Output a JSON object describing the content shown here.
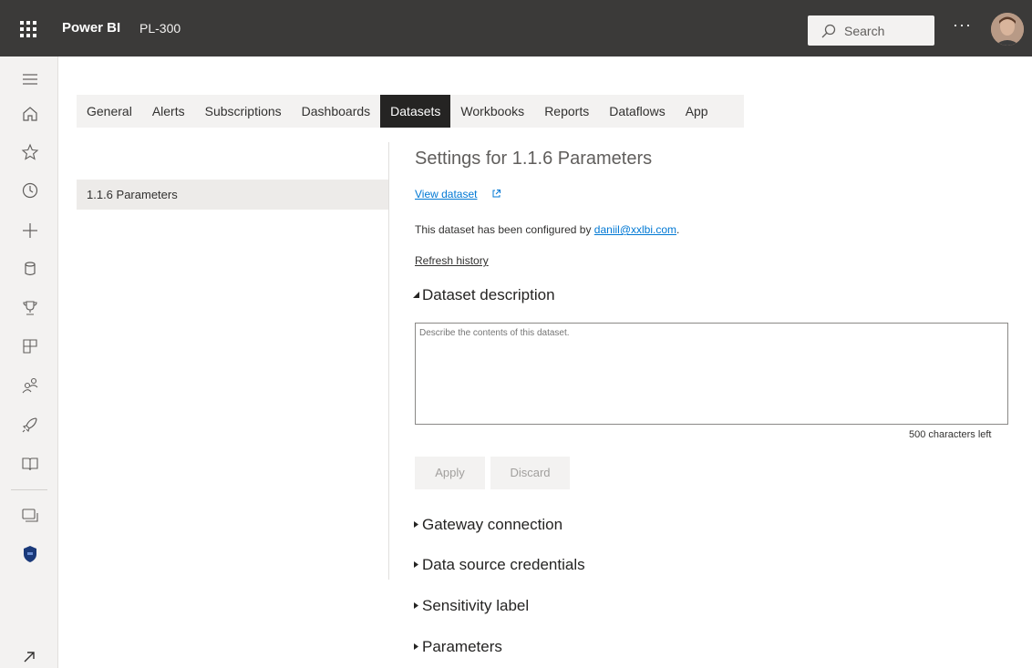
{
  "topbar": {
    "brand": "Power BI",
    "workspace": "PL-300",
    "search_label": "Search",
    "more_label": "···",
    "search_icon": "search-icon",
    "app_launcher_icon": "waffle-icon",
    "bg_color": "#3b3a39"
  },
  "leftnav": {
    "icons": [
      "hamburger-icon",
      "home-icon",
      "star-icon",
      "clock-icon",
      "plus-icon",
      "database-icon",
      "trophy-icon",
      "apps-icon",
      "people-icon",
      "rocket-icon",
      "book-icon",
      "workspaces-icon",
      "shield-icon",
      "expand-icon"
    ]
  },
  "tabs": [
    {
      "label": "General"
    },
    {
      "label": "Alerts"
    },
    {
      "label": "Subscriptions"
    },
    {
      "label": "Dashboards"
    },
    {
      "label": "Datasets",
      "active": true
    },
    {
      "label": "Workbooks"
    },
    {
      "label": "Reports"
    },
    {
      "label": "Dataflows"
    },
    {
      "label": "App"
    }
  ],
  "datasets_list": {
    "items": [
      {
        "label": "1.1.6 Parameters",
        "selected": true
      }
    ]
  },
  "settings": {
    "title": "Settings for 1.1.6 Parameters",
    "view_dataset": "View dataset",
    "configured_prefix": "This dataset has been configured by ",
    "configured_email": "daniil@xxlbi.com",
    "configured_suffix": ".",
    "refresh_history": "Refresh history",
    "description_section": "Dataset description",
    "description_placeholder": "Describe the contents of this dataset.",
    "chars_left": "500 characters left",
    "apply_label": "Apply",
    "discard_label": "Discard",
    "collapsed_sections": [
      "Gateway connection",
      "Data source credentials",
      "Sensitivity label",
      "Parameters"
    ]
  },
  "colors": {
    "accent_link": "#0078d4",
    "active_tab_bg": "#252423",
    "shield": "#1a3a7a"
  }
}
